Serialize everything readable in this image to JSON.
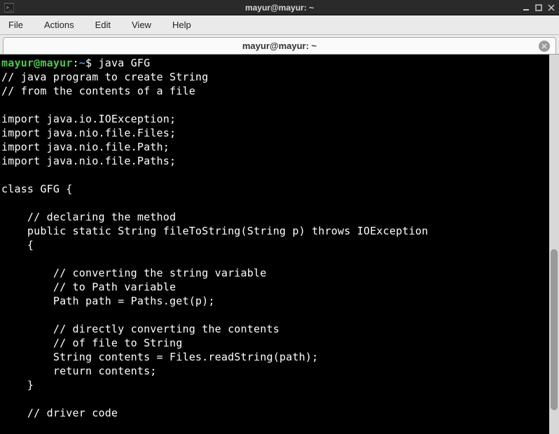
{
  "window": {
    "title": "mayur@mayur: ~"
  },
  "menu": {
    "file": "File",
    "actions": "Actions",
    "edit": "Edit",
    "view": "View",
    "help": "Help"
  },
  "tab": {
    "title": "mayur@mayur: ~"
  },
  "prompt": {
    "user": "mayur",
    "at": "@",
    "host": "mayur",
    "colon": ":",
    "path": "~",
    "dollar": "$"
  },
  "command": "java GFG",
  "output_lines": [
    "// java program to create String",
    "// from the contents of a file",
    "",
    "import java.io.IOException;",
    "import java.nio.file.Files;",
    "import java.nio.file.Path;",
    "import java.nio.file.Paths;",
    "",
    "class GFG {",
    "",
    "    // declaring the method",
    "    public static String fileToString(String p) throws IOException",
    "    {",
    "",
    "        // converting the string variable",
    "        // to Path variable",
    "        Path path = Paths.get(p);",
    "",
    "        // directly converting the contents",
    "        // of file to String",
    "        String contents = Files.readString(path);",
    "        return contents;",
    "    }",
    "",
    "    // driver code"
  ]
}
